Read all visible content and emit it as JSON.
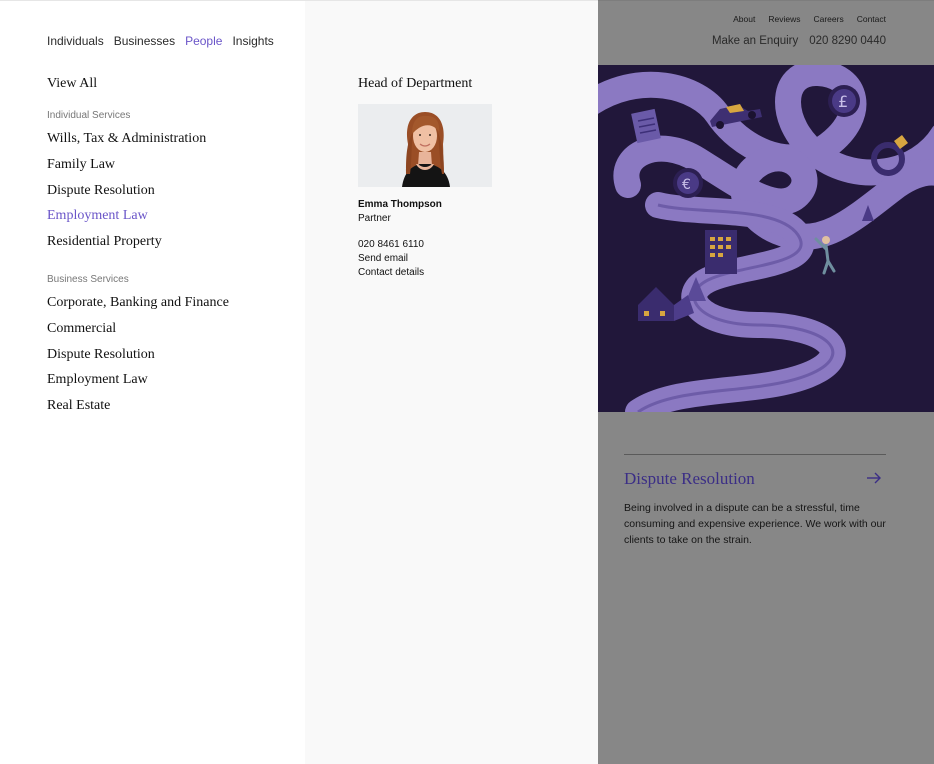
{
  "nav": {
    "tabs": [
      {
        "label": "Individuals",
        "active": false
      },
      {
        "label": "Businesses",
        "active": false
      },
      {
        "label": "People",
        "active": true
      },
      {
        "label": "Insights",
        "active": false
      }
    ],
    "view_all": "View All"
  },
  "individual_services": {
    "heading": "Individual Services",
    "items": [
      "Wills, Tax & Administration",
      "Family Law",
      "Dispute Resolution",
      "Employment Law",
      "Residential Property"
    ],
    "active_item": "Employment Law"
  },
  "business_services": {
    "heading": "Business Services",
    "items": [
      "Corporate, Banking and Finance",
      "Commercial",
      "Dispute Resolution",
      "Employment Law",
      "Real Estate"
    ]
  },
  "head_of_department": {
    "title": "Head of Department",
    "name": "Emma Thompson",
    "role": "Partner",
    "phone": "020 8461 6110",
    "email_link": "Send email",
    "details_link": "Contact details"
  },
  "utility_nav": [
    "About",
    "Reviews",
    "Careers",
    "Contact"
  ],
  "enquiry": {
    "label": "Make an Enquiry",
    "phone": "020 8290 0440"
  },
  "feature": {
    "title": "Dispute Resolution",
    "description": "Being involved in a dispute can be a stressful, time consuming and expensive experience. We work with our clients to take on the strain."
  },
  "colors": {
    "accent": "#6a55c8",
    "overlay": "#878787",
    "hero_bg": "#21173a",
    "feature_title": "#3b2e86"
  },
  "icons": [
    "arrow-right-icon"
  ]
}
